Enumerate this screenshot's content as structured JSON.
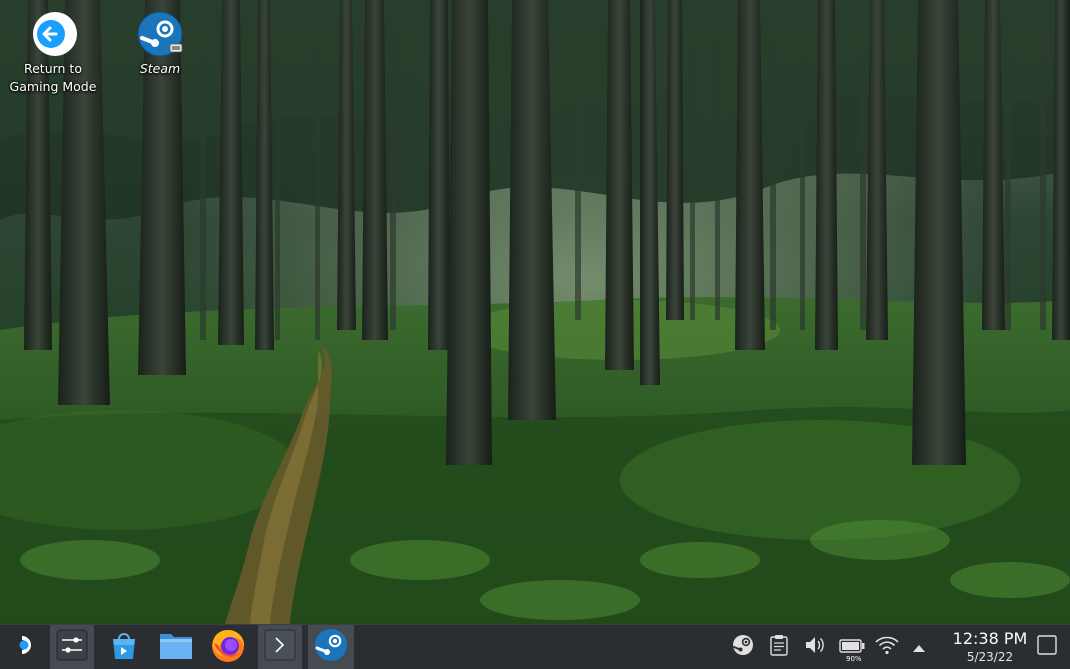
{
  "desktop": {
    "icons": [
      {
        "id": "return",
        "label_line1": "Return to",
        "label_line2": "Gaming Mode",
        "icon": "return-arrow-icon"
      },
      {
        "id": "steam",
        "label": "Steam",
        "icon": "steam-icon"
      }
    ]
  },
  "taskbar": {
    "launchers": [
      {
        "id": "app-launcher",
        "icon": "steamdeck-launcher-icon"
      },
      {
        "id": "system-settings",
        "icon": "settings-sliders-icon"
      },
      {
        "id": "discover",
        "icon": "shopping-bag-icon"
      },
      {
        "id": "dolphin",
        "icon": "folder-icon"
      },
      {
        "id": "firefox",
        "icon": "firefox-icon"
      },
      {
        "id": "konsole",
        "icon": "terminal-icon"
      },
      {
        "id": "steam",
        "icon": "steam-icon"
      }
    ],
    "tray": {
      "battery_percent": "90%",
      "time": "12:38 PM",
      "date": "5/23/22"
    }
  },
  "colors": {
    "taskbar_bg": "#2a2e32",
    "accent_blue": "#1a9fff",
    "steam_blue": "#1b75bb"
  }
}
